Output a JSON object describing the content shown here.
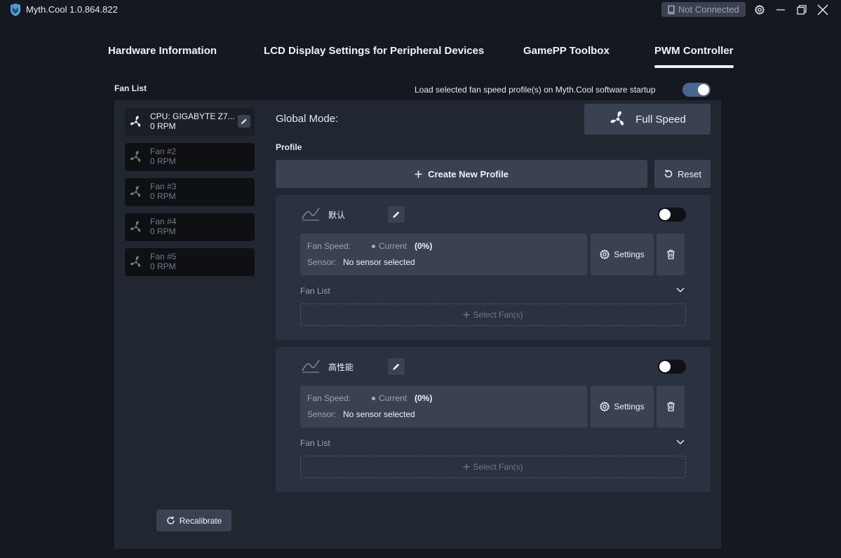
{
  "titlebar": {
    "app_title": "Myth.Cool  1.0.864.822",
    "connection_status": "Not Connected"
  },
  "tabs": [
    {
      "label": "Hardware Information",
      "active": false
    },
    {
      "label": "LCD Display Settings for Peripheral Devices",
      "active": false
    },
    {
      "label": "GamePP Toolbox",
      "active": false
    },
    {
      "label": "PWM Controller",
      "active": true
    }
  ],
  "fan_list": {
    "title": "Fan List",
    "fans": [
      {
        "name": "CPU: GIGABYTE Z7...",
        "rpm": "0 RPM",
        "active": true
      },
      {
        "name": "Fan #2",
        "rpm": "0 RPM",
        "active": false
      },
      {
        "name": "Fan #3",
        "rpm": "0 RPM",
        "active": false
      },
      {
        "name": "Fan #4",
        "rpm": "0 RPM",
        "active": false
      },
      {
        "name": "Fan #5",
        "rpm": "0 RPM",
        "active": false
      }
    ],
    "recalibrate_label": "Recalibrate"
  },
  "controller": {
    "startup_label": "Load selected fan speed profile(s) on Myth.Cool software startup",
    "startup_enabled": true,
    "global_mode_label": "Global Mode:",
    "global_mode_value": "Full Speed",
    "profile_label": "Profile",
    "create_profile_label": "Create New Profile",
    "reset_label": "Reset"
  },
  "profiles": [
    {
      "name": "默认",
      "enabled": false,
      "fan_speed_label": "Fan Speed:",
      "current_label": "Current",
      "current_value": "(0%)",
      "sensor_label": "Sensor:",
      "sensor_value": "No sensor selected",
      "settings_label": "Settings",
      "fan_list_label": "Fan List",
      "select_fans_label": "Select Fan(s)"
    },
    {
      "name": "高性能",
      "enabled": false,
      "fan_speed_label": "Fan Speed:",
      "current_label": "Current",
      "current_value": "(0%)",
      "sensor_label": "Sensor:",
      "sensor_value": "No sensor selected",
      "settings_label": "Settings",
      "fan_list_label": "Fan List",
      "select_fans_label": "Select Fan(s)"
    }
  ],
  "colors": {
    "background": "#15181e",
    "panel": "#212731",
    "card": "#2a3140",
    "button": "#3a4252",
    "toggle_on": "#4a6590"
  },
  "icons": {
    "app_logo": "myth-cool-logo",
    "connection": "device-icon",
    "settings": "gear-icon",
    "fan": "fan-icon",
    "edit": "pencil-icon",
    "recalibrate": "refresh-icon",
    "create": "plus-icon",
    "reset": "reset-icon",
    "curve": "curve-icon",
    "delete": "trash-icon",
    "expand": "chevron-down-icon"
  }
}
